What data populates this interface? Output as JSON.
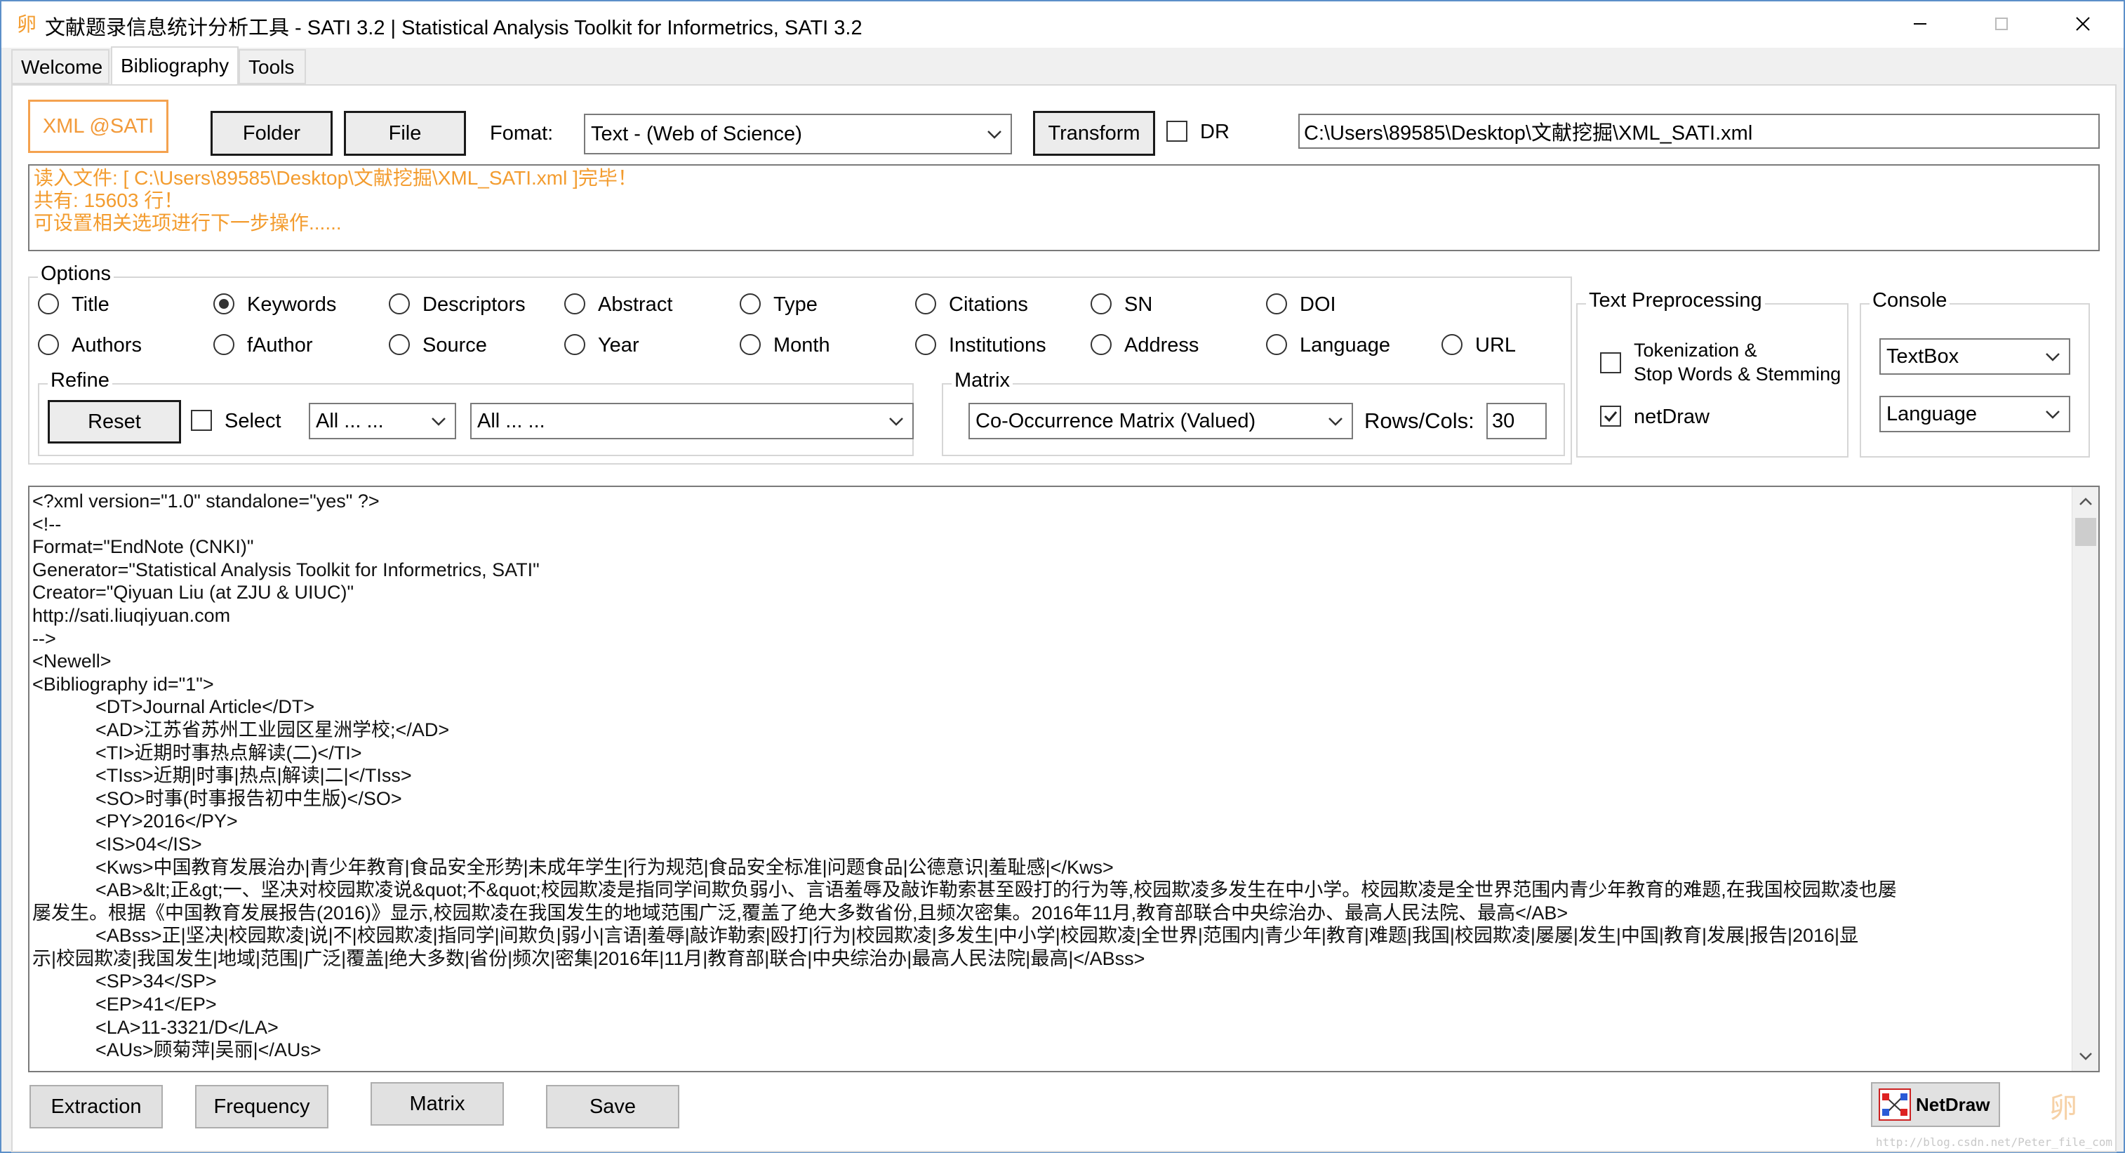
{
  "window": {
    "title": "文献题录信息统计分析工具 - SATI 3.2 | Statistical Analysis Toolkit for Informetrics, SATI 3.2",
    "accent_color": "#f39c2f",
    "icon": "sati-app-icon"
  },
  "tabs": [
    {
      "label": "Welcome",
      "active": false
    },
    {
      "label": "Bibliography",
      "active": true
    },
    {
      "label": "Tools",
      "active": false
    }
  ],
  "toolbar": {
    "xml_button": "XML @SATI",
    "folder_button": "Folder",
    "file_button": "File",
    "format_label": "Fomat:",
    "format_value": "Text - (Web of Science)",
    "transform_button": "Transform",
    "dr_label": "DR",
    "dr_checked": false,
    "path_value": "C:\\Users\\89585\\Desktop\\文献挖掘\\XML_SATI.xml"
  },
  "status": {
    "lines": [
      "读入文件: [ C:\\Users\\89585\\Desktop\\文献挖掘\\XML_SATI.xml ]完毕！",
      "共有: 15603 行！",
      "可设置相关选项进行下一步操作......"
    ]
  },
  "options": {
    "title": "Options",
    "radios": [
      {
        "label": "Title",
        "checked": false
      },
      {
        "label": "Keywords",
        "checked": true
      },
      {
        "label": "Descriptors",
        "checked": false
      },
      {
        "label": "Abstract",
        "checked": false
      },
      {
        "label": "Type",
        "checked": false
      },
      {
        "label": "Citations",
        "checked": false
      },
      {
        "label": "SN",
        "checked": false
      },
      {
        "label": "DOI",
        "checked": false
      },
      {
        "label": "Authors",
        "checked": false
      },
      {
        "label": "fAuthor",
        "checked": false
      },
      {
        "label": "Source",
        "checked": false
      },
      {
        "label": "Year",
        "checked": false
      },
      {
        "label": "Month",
        "checked": false
      },
      {
        "label": "Institutions",
        "checked": false
      },
      {
        "label": "Address",
        "checked": false
      },
      {
        "label": "Language",
        "checked": false
      },
      {
        "label": "URL",
        "checked": false
      }
    ],
    "refine": {
      "title": "Refine",
      "reset_button": "Reset",
      "select_label": "Select",
      "select_checked": false,
      "combo1_value": "All ... ...",
      "combo2_value": "All ... ..."
    },
    "matrix": {
      "title": "Matrix",
      "type_value": "Co-Occurrence Matrix (Valued)",
      "rows_cols_label": "Rows/Cols:",
      "rows_cols_value": "30"
    }
  },
  "text_preprocessing": {
    "title": "Text Preprocessing",
    "tokenization_label_1": "Tokenization &",
    "tokenization_label_2": "Stop Words & Stemming",
    "tokenization_checked": false,
    "netdraw_label": "netDraw",
    "netdraw_checked": true
  },
  "console": {
    "title": "Console",
    "output_value": "TextBox",
    "language_value": "Language"
  },
  "editor": {
    "lines": [
      "<?xml version=\"1.0\" standalone=\"yes\" ?>",
      "<!--",
      "Format=\"EndNote (CNKI)\"",
      "Generator=\"Statistical Analysis Toolkit for Informetrics, SATI\"",
      "Creator=\"Qiyuan Liu (at ZJU & UIUC)\"",
      "http://sati.liuqiyuan.com",
      "-->",
      "<Newell>",
      "<Bibliography id=\"1\">",
      "            <DT>Journal Article</DT>",
      "            <AD>江苏省苏州工业园区星洲学校;</AD>",
      "            <TI>近期时事热点解读(二)</TI>",
      "            <TIss>近期|时事|热点|解读|二|</TIss>",
      "            <SO>时事(时事报告初中生版)</SO>",
      "            <PY>2016</PY>",
      "            <IS>04</IS>",
      "            <Kws>中国教育发展治办|青少年教育|食品安全形势|未成年学生|行为规范|食品安全标准|问题食品|公德意识|羞耻感|</Kws>",
      "            <AB>&lt;正&gt;一、坚决对校园欺凌说&quot;不&quot;校园欺凌是指同学间欺负弱小、言语羞辱及敲诈勒索甚至殴打的行为等,校园欺凌多发生在中小学。校园欺凌是全世界范围内青少年教育的难题,在我国校园欺凌也屡",
      "屡发生。根据《中国教育发展报告(2016)》显示,校园欺凌在我国发生的地域范围广泛,覆盖了绝大多数省份,且频次密集。2016年11月,教育部联合中央综治办、最高人民法院、最高</AB>",
      "            <ABss>正|坚决|校园欺凌|说|不|校园欺凌|指同学|间欺负|弱小|言语|羞辱|敲诈勒索|殴打|行为|校园欺凌|多发生|中小学|校园欺凌|全世界|范围内|青少年|教育|难题|我国|校园欺凌|屡屡|发生|中国|教育|发展|报告|2016|显",
      "示|校园欺凌|我国发生|地域|范围|广泛|覆盖|绝大多数|省份|频次|密集|2016年|11月|教育部|联合|中央综治办|最高人民法院|最高|</ABss>",
      "            <SP>34</SP>",
      "            <EP>41</EP>",
      "            <LA>11-3321/D</LA>",
      "            <AUs>顾菊萍|吴丽|</AUs>"
    ]
  },
  "bottom": {
    "extraction_button": "Extraction",
    "frequency_button": "Frequency",
    "matrix_button": "Matrix",
    "save_button": "Save",
    "netdraw_button": "NetDraw",
    "watermark": "http://blog.csdn.net/Peter_file_com"
  }
}
